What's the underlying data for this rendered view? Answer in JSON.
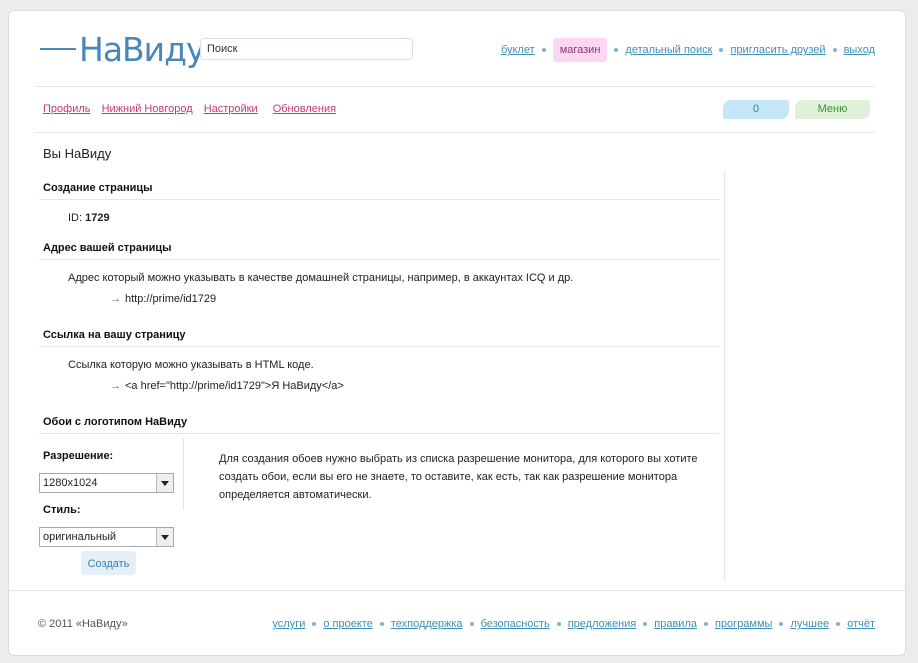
{
  "header": {
    "logo_text": "НаВиду",
    "search_placeholder": "Поиск",
    "nav": [
      {
        "label": "буклет"
      },
      {
        "label": "магазин"
      },
      {
        "label": "детальный поиск"
      },
      {
        "label": "пригласить друзей"
      },
      {
        "label": "выход"
      }
    ]
  },
  "subnav": {
    "links": [
      "Профиль",
      "Нижний Новгород",
      "Настройки",
      "Обновления"
    ],
    "count": "0",
    "menu": "Меню"
  },
  "page_title": "Вы НаВиду",
  "sections": {
    "create": {
      "title": "Создание страницы",
      "id_label": "ID:",
      "id_value": "1729"
    },
    "address": {
      "title": "Адрес вашей страницы",
      "desc": "Адрес который можно указывать в качестве домашней страницы, например, в аккаунтах ICQ и др.",
      "arrow": "→",
      "value": "http://prime/id1729"
    },
    "link": {
      "title": "Ссылка на вашу страницу",
      "desc": "Ссылка которую можно указывать в HTML коде.",
      "arrow": "→",
      "value": "<a href=\"http://prime/id1729\">Я НаВиду</a>"
    },
    "wallpaper": {
      "title": "Обои с логотипом НаВиду",
      "resolution_label": "Разрешение:",
      "resolution_value": "1280x1024",
      "style_label": "Стиль:",
      "style_value": "оригинальный",
      "create_button": "Создать",
      "description": "Для создания обоев нужно выбрать из списка разрешение монитора, для которого вы хотите создать обои, если вы его не знаете, то оставите, как есть, так как разрешение монитора определяется автоматически."
    }
  },
  "footer": {
    "copyright": "© 2011 «НаВиду»",
    "links": [
      "услуги",
      "о проекте",
      "техподдержка",
      "безопасность",
      "предложения",
      "правила",
      "программы",
      "лучшее",
      "отчёт"
    ]
  },
  "colors": {
    "link": "#3f8fb4",
    "accent_link": "#c33a72",
    "shop_bg": "#fcd6f2",
    "count_bg": "#c4e6f6",
    "menu_bg": "#dff1d9"
  }
}
